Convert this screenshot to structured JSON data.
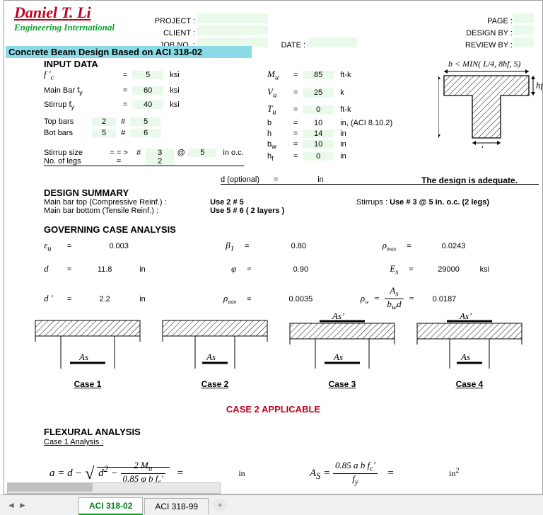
{
  "logo": {
    "name": "Daniel T. Li",
    "sub": "Engineering International"
  },
  "header": {
    "labels": {
      "project": "PROJECT :",
      "client": "CLIENT :",
      "jobno": "JOB NO. :",
      "date": "DATE :",
      "page": "PAGE :",
      "designby": "DESIGN BY :",
      "reviewby": "REVIEW BY :"
    }
  },
  "title": "Concrete Beam Design Based on ACI 318-02",
  "input": {
    "heading": "INPUT DATA",
    "left": [
      {
        "l": "f '",
        "sub": "c",
        "e": "=",
        "v": "5",
        "u": "ksi"
      },
      {
        "l": "Main Bar f",
        "sub": "y",
        "e": "=",
        "v": "60",
        "u": "ksi"
      },
      {
        "l": "Stirrup f",
        "sub": "y",
        "e": "=",
        "v": "40",
        "u": "ksi"
      }
    ],
    "topbars": {
      "l": "Top bars",
      "count": "2",
      "sym": "#",
      "size": "5"
    },
    "botbars": {
      "l": "Bot bars",
      "count": "5",
      "sym": "#",
      "size": "6"
    },
    "stirrupsize": {
      "l": "Stirrup size",
      "arrow": "= = >",
      "sym": "#",
      "size": "3",
      "at": "@",
      "spacing": "5",
      "u": "in o.c."
    },
    "nolegs": {
      "l": "No. of legs",
      "e": "=",
      "v": "2",
      "dopt": "d (optional)",
      "e2": "=",
      "u": "in"
    },
    "right": [
      {
        "l": "M",
        "sub": "u",
        "e": "=",
        "v": "85",
        "u": "ft-k"
      },
      {
        "l": "V",
        "sub": "u",
        "e": "=",
        "v": "25",
        "u": "k"
      },
      {
        "l": "T",
        "sub": "u",
        "e": "=",
        "v": "0",
        "u": "ft-k"
      },
      {
        "l": "b",
        "e": "=",
        "v": "10",
        "u": "in, (ACI 8.10.2)"
      },
      {
        "l": "h",
        "e": "=",
        "v": "14",
        "u": "in"
      },
      {
        "l": "b",
        "sub": "w",
        "e": "=",
        "v": "10",
        "u": "in"
      },
      {
        "l": "h",
        "sub": "f",
        "e": "=",
        "v": "0",
        "u": "in"
      }
    ],
    "section_caption": "b  <  MIN( L/4, 8hf, S)",
    "design_ok": "The design is adequate."
  },
  "summary": {
    "heading": "DESIGN SUMMARY",
    "row1": {
      "l": "Main bar top (Compressive Reinf.) :",
      "v": "Use  2 # 5"
    },
    "row2": {
      "l": "Main bar bottom (Tensile Reinf.) :",
      "v": "Use  5 # 6 ( 2 layers )"
    },
    "stirr": {
      "l": "Stirrups :",
      "v": "Use # 3 @ 5 in. o.c.   (2 legs)"
    }
  },
  "gov": {
    "heading": "GOVERNING CASE ANALYSIS",
    "rows": [
      {
        "l": "ε",
        "sub": "u",
        "e": "=",
        "v": "0.003",
        "l2": "β",
        "sub2": "1",
        "e2": "=",
        "v2": "0.80",
        "l3": "ρ",
        "sub3": "max",
        "e3": "=",
        "v3": "0.0243"
      },
      {
        "l": "d",
        "e": "=",
        "v": "11.8",
        "u": "in",
        "l2": "φ",
        "e2": "=",
        "v2": "0.90",
        "l3": "E",
        "sub3": "s",
        "e3": "=",
        "v3": "29000",
        "u3": "ksi"
      },
      {
        "l": "d '",
        "e": "=",
        "v": "2.2",
        "u": "in",
        "l2": "ρ",
        "sub2": "min",
        "e2": "=",
        "v2": "0.0035",
        "l3": "ρ",
        "sub3": "w",
        "l3extra": "= A",
        "v3": "0.0187",
        "frac": {
          "num": "A s",
          "den": "b w d"
        }
      }
    ]
  },
  "cases": {
    "c1": "Case 1",
    "c2": "Case 2",
    "c3": "Case 3",
    "c4": "Case 4",
    "applicable": "CASE 2  APPLICABLE",
    "As": "As",
    "Asp": "As’"
  },
  "flex": {
    "heading": "FLEXURAL ANALYSIS",
    "sub": "Case 1 Analysis :",
    "eq1": {
      "lhs": "a = d −",
      "radA": "d",
      "radB": "2",
      "num": "2 M",
      "den": "0.85 φ b f",
      "u": "in",
      "sq": "²"
    },
    "eq2": {
      "lhs": "A",
      "sub": "S",
      "num": "0.85 a b f",
      "den": "f",
      "apos": "c’",
      "rhs": "",
      "u": "in",
      "sq": "2"
    }
  },
  "tabs": {
    "active": "ACI 318-02",
    "other": "ACI 318-99"
  }
}
